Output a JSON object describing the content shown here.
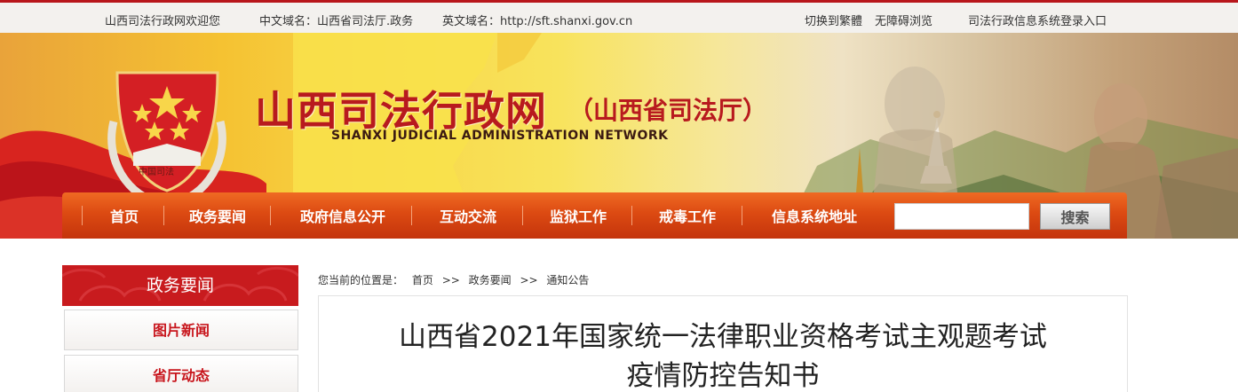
{
  "topbar": {
    "welcome": "山西司法行政网欢迎您",
    "cn_domain": "中文域名：山西省司法厅.政务",
    "en_domain": "英文域名：http://sft.shanxi.gov.cn",
    "switch_traditional": "切换到繁體",
    "accessibility": "无障碍浏览",
    "system_login": "司法行政信息系统登录入口"
  },
  "banner": {
    "title_cn": "山西司法行政网",
    "title_sub": "（山西省司法厅）",
    "title_en": "SHANXI JUDICIAL ADMINISTRATION NETWORK",
    "emblem_text": "中国司法"
  },
  "nav": {
    "items": [
      {
        "label": "首页"
      },
      {
        "label": "政务要闻"
      },
      {
        "label": "政府信息公开"
      },
      {
        "label": "互动交流"
      },
      {
        "label": "监狱工作"
      },
      {
        "label": "戒毒工作"
      },
      {
        "label": "信息系统地址"
      }
    ],
    "search_value": "",
    "search_button": "搜索"
  },
  "sidebar": {
    "header": "政务要闻",
    "items": [
      {
        "label": "图片新闻"
      },
      {
        "label": "省厅动态"
      }
    ]
  },
  "breadcrumb": {
    "prefix": "您当前的位置是：",
    "items": [
      "首页",
      ">>",
      "政务要闻",
      ">>",
      "通知公告"
    ]
  },
  "article": {
    "title_line1": "山西省2021年国家统一法律职业资格考试主观题考试",
    "title_line2": "疫情防控告知书"
  },
  "colors": {
    "brand_red": "#c81b1e",
    "nav_orange": "#dc4a12",
    "topbar_bg": "#f3f1ee"
  }
}
